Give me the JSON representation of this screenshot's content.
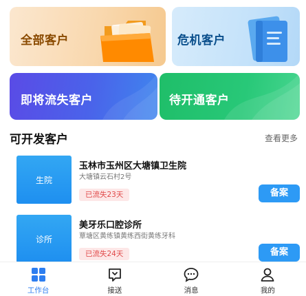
{
  "cards": {
    "all": "全部客户",
    "crisis": "危机客户",
    "loss": "即将流失客户",
    "open": "待开通客户"
  },
  "section": {
    "title": "可开发客户",
    "more": "查看更多"
  },
  "customers": [
    {
      "thumb": "生院",
      "name": "玉林市玉州区大塘镇卫生院",
      "address": "大塘镇云石村2号",
      "badge": "已流失23天",
      "action": "备案"
    },
    {
      "thumb": "诊所",
      "name": "美牙乐口腔诊所",
      "address": "覃塘区黄练镇黄练西街黄练牙科",
      "badge": "已流失24天",
      "action": "备案"
    }
  ],
  "tabs": [
    {
      "label": "工作台",
      "icon": "grid-icon",
      "active": true
    },
    {
      "label": "接送",
      "icon": "chat-square-icon"
    },
    {
      "label": "消息",
      "icon": "message-bubble-icon"
    },
    {
      "label": "我的",
      "icon": "user-icon"
    }
  ],
  "colors": {
    "accent": "#2d7ef0",
    "button": "#2d9af5",
    "badge_text": "#e04848"
  }
}
